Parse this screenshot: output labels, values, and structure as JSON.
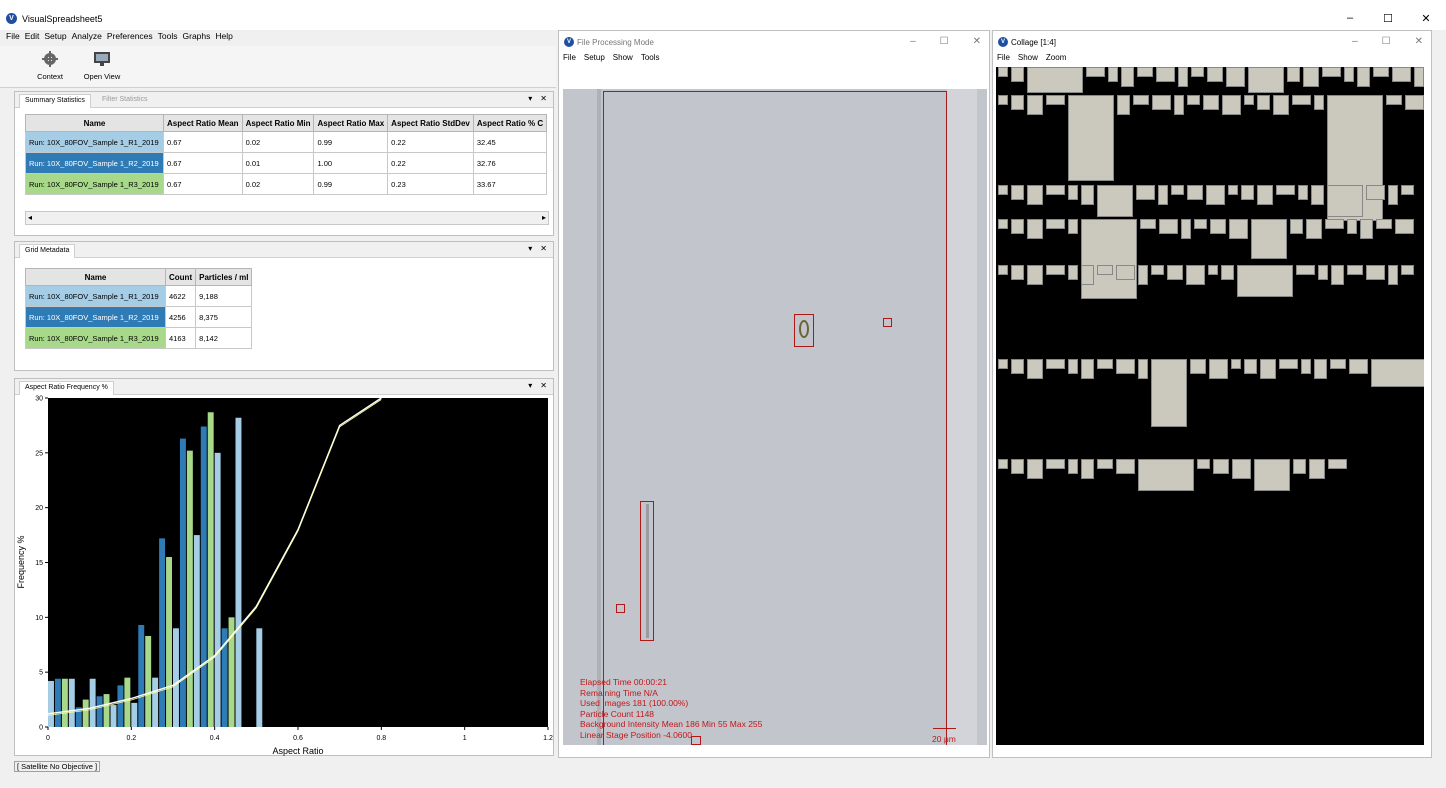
{
  "app": {
    "title": "VisualSpreadsheet5",
    "logo": "visualspreadsheet-logo-icon"
  },
  "menu": [
    "File",
    "Edit",
    "Setup",
    "Analyze",
    "Preferences",
    "Tools",
    "Graphs",
    "Help"
  ],
  "toolbar": {
    "context_label": "Context",
    "open_view_label": "Open View"
  },
  "summary": {
    "tabs": [
      "Summary Statistics",
      "Filter Statistics"
    ],
    "columns": [
      "Name",
      "Aspect Ratio Mean",
      "Aspect Ratio Min",
      "Aspect Ratio Max",
      "Aspect Ratio StdDev",
      "Aspect Ratio % C"
    ],
    "rows": [
      [
        "Run: 10X_80FOV_Sample 1_R1_2019",
        "0.67",
        "0.02",
        "0.99",
        "0.22",
        "32.45"
      ],
      [
        "Run: 10X_80FOV_Sample 1_R2_2019",
        "0.67",
        "0.01",
        "1.00",
        "0.22",
        "32.76"
      ],
      [
        "Run: 10X_80FOV_Sample 1_R3_2019",
        "0.67",
        "0.02",
        "0.99",
        "0.23",
        "33.67"
      ]
    ]
  },
  "grid": {
    "tab": "Grid Metadata",
    "columns": [
      "Name",
      "Count",
      "Particles / ml"
    ],
    "rows": [
      [
        "Run: 10X_80FOV_Sample 1_R1_2019",
        "4622",
        "9,188"
      ],
      [
        "Run: 10X_80FOV_Sample 1_R2_2019",
        "4256",
        "8,375"
      ],
      [
        "Run: 10X_80FOV_Sample 1_R3_2019",
        "4163",
        "8,142"
      ]
    ]
  },
  "histogram": {
    "tab": "Aspect Ratio Frequency %",
    "colors": {
      "r1": "#a6cde6",
      "r2": "#2f7bb6",
      "r3": "#a8d98a"
    }
  },
  "chart_data": {
    "type": "bar",
    "xlabel": "Aspect Ratio",
    "ylabel": "Frequency %",
    "xlim": [
      0,
      1.2
    ],
    "ylim": [
      0,
      30
    ],
    "x_ticks": [
      "0",
      "0.2",
      "0.4",
      "0.6",
      "0.8",
      "1",
      "1.2"
    ],
    "y_ticks": [
      "0",
      "5",
      "10",
      "15",
      "20",
      "25",
      "30"
    ],
    "bin_width": 0.05,
    "bin_starts": [
      0.0,
      0.05,
      0.1,
      0.15,
      0.2,
      0.25,
      0.3,
      0.35,
      0.4,
      0.45,
      0.5,
      0.55,
      0.6,
      0.65,
      0.7,
      0.75,
      0.8,
      0.85,
      0.9,
      0.95,
      1.0
    ],
    "series": [
      {
        "values": [
          4.2,
          4.4,
          4.4,
          2.0,
          2.2,
          4.5,
          9.0,
          17.5,
          25.0,
          28.2,
          9.0,
          0,
          0,
          0,
          0,
          0,
          0,
          0,
          0,
          0,
          0
        ]
      },
      {
        "values": [
          4.4,
          1.8,
          2.8,
          3.8,
          9.3,
          17.2,
          26.3,
          27.4,
          9.0,
          0,
          0,
          0,
          0,
          0,
          0,
          0,
          0,
          0,
          0,
          0,
          0
        ]
      },
      {
        "values": [
          4.4,
          2.5,
          3.0,
          4.5,
          8.3,
          15.5,
          25.2,
          28.7,
          10.0,
          0,
          0,
          0,
          0,
          0,
          0,
          0,
          0,
          0,
          0,
          0,
          0
        ]
      }
    ],
    "cumulative_line": [
      [
        0.0,
        1.2
      ],
      [
        0.1,
        1.7
      ],
      [
        0.2,
        2.6
      ],
      [
        0.3,
        3.8
      ],
      [
        0.4,
        6.5
      ],
      [
        0.5,
        11.0
      ],
      [
        0.6,
        18.0
      ],
      [
        0.7,
        27.5
      ],
      [
        0.8,
        30.0
      ]
    ],
    "grid": false
  },
  "fpm": {
    "title": "File Processing Mode",
    "menu": [
      "File",
      "Setup",
      "Show",
      "Tools"
    ],
    "overlay": [
      "Elapsed Time  00:00:21",
      "Remaining Time  N/A",
      "Used Images  181  (100.00%)",
      "Particle Count  1148",
      "Background Intensity Mean 186  Min 55  Max 255",
      "Linear Stage Position  -4.0600"
    ],
    "scale_label": "20 μm"
  },
  "collage": {
    "title": "Collage  [1:4]",
    "menu": [
      "File",
      "Show",
      "Zoom"
    ]
  },
  "status": "[ Satellite No Objective ]",
  "window_controls": {
    "minimize": "–",
    "maximize": "☐",
    "close": "✕"
  }
}
